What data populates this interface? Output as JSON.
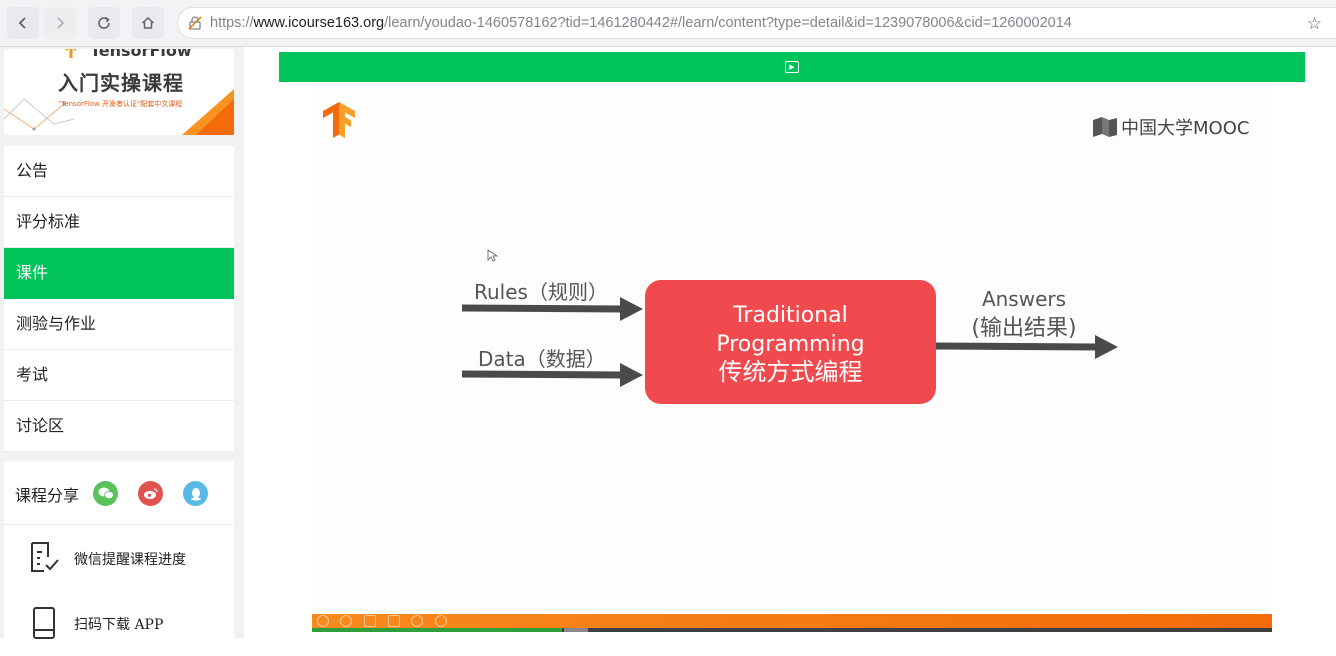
{
  "browser": {
    "url_host": "www.icourse163.org",
    "url_prefix": "https://",
    "url_path": "/learn/youdao-1460578162?tid=1461280442#/learn/content?type=detail&id=1239078006&cid=1260002014"
  },
  "sidebar": {
    "banner": {
      "top_text": "TensorFlow",
      "title": "入门实操课程",
      "subtitle": "\"TensorFlow 开发者认证\"配套中文课程"
    },
    "menu": [
      {
        "label": "公告"
      },
      {
        "label": "评分标准"
      },
      {
        "label": "课件"
      },
      {
        "label": "测验与作业"
      },
      {
        "label": "考试"
      },
      {
        "label": "讨论区"
      }
    ],
    "share_label": "课程分享",
    "tools": [
      {
        "label": "微信提醒课程进度"
      },
      {
        "label": "扫码下载 APP"
      }
    ]
  },
  "slide": {
    "brand": "中国大学MOOC",
    "inputs": [
      {
        "label": "Rules（规则）"
      },
      {
        "label": "Data（数据）"
      }
    ],
    "box_line1": "Traditional",
    "box_line2": "Programming",
    "box_line3": "传统方式编程",
    "output_line1": "Answers",
    "output_line2": "(输出结果)"
  },
  "player": {
    "played_fraction": 0.26
  },
  "colors": {
    "accent_green": "#00c35a",
    "box_red": "#f04a4f",
    "arrow_gray": "#4a4a4a",
    "progress_orange": "#f78a1d"
  }
}
